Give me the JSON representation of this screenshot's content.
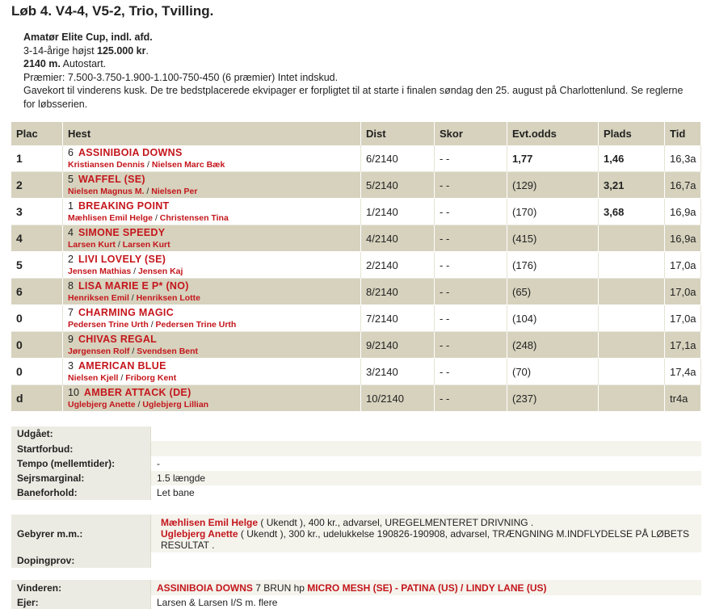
{
  "title": "Løb 4. V4-4, V5-2, Trio, Tvilling.",
  "race_info": {
    "line1": "Amatør Elite Cup, indl. afd.",
    "line2_prefix": "3-14-årige højst ",
    "line2_amount": "125.000 kr",
    "line2_suffix": ".",
    "line3_distance": "2140 m.",
    "line3_start": " Autostart.",
    "line4": "Præmier: 7.500-3.750-1.900-1.100-750-450 (6 præmier) Intet indskud.",
    "line5": "Gavekort til vinderens kusk. De tre bedstplacerede ekvipager er forpligtet til at starte i finalen søndag den 25. august på Charlottenlund. Se reglerne for løbsserien."
  },
  "table": {
    "headers": [
      "Plac",
      "Hest",
      "Dist",
      "Skor",
      "Evt.odds",
      "Plads",
      "Tid"
    ],
    "rows": [
      {
        "plac": "1",
        "num": "6",
        "horse": "ASSINIBOIA DOWNS",
        "driver": "Kristiansen Dennis",
        "trainer": "Nielsen Marc Bæk",
        "dist": "6/2140",
        "skor": "- -",
        "odds": "1,77",
        "plads": "1,46",
        "tid": "16,3a"
      },
      {
        "plac": "2",
        "num": "5",
        "horse": "WAFFEL (SE)",
        "driver": "Nielsen Magnus M.",
        "trainer": "Nielsen Per",
        "dist": "5/2140",
        "skor": "- -",
        "odds": "(129)",
        "plads": "3,21",
        "tid": "16,7a"
      },
      {
        "plac": "3",
        "num": "1",
        "horse": "BREAKING POINT",
        "driver": "Mæhlisen Emil Helge",
        "trainer": "Christensen Tina",
        "dist": "1/2140",
        "skor": "- -",
        "odds": "(170)",
        "plads": "3,68",
        "tid": "16,9a"
      },
      {
        "plac": "4",
        "num": "4",
        "horse": "SIMONE SPEEDY",
        "driver": "Larsen Kurt",
        "trainer": "Larsen Kurt",
        "dist": "4/2140",
        "skor": "- -",
        "odds": "(415)",
        "plads": "",
        "tid": "16,9a"
      },
      {
        "plac": "5",
        "num": "2",
        "horse": "LIVI LOVELY (SE)",
        "driver": "Jensen Mathias",
        "trainer": "Jensen Kaj",
        "dist": "2/2140",
        "skor": "- -",
        "odds": "(176)",
        "plads": "",
        "tid": "17,0a"
      },
      {
        "plac": "6",
        "num": "8",
        "horse": "LISA MARIE E P* (NO)",
        "driver": "Henriksen Emil",
        "trainer": "Henriksen Lotte",
        "dist": "8/2140",
        "skor": "- -",
        "odds": "(65)",
        "plads": "",
        "tid": "17,0a"
      },
      {
        "plac": "0",
        "num": "7",
        "horse": "CHARMING MAGIC",
        "driver": "Pedersen Trine Urth",
        "trainer": "Pedersen Trine Urth",
        "dist": "7/2140",
        "skor": "- -",
        "odds": "(104)",
        "plads": "",
        "tid": "17,0a"
      },
      {
        "plac": "0",
        "num": "9",
        "horse": "CHIVAS REGAL",
        "driver": "Jørgensen Rolf",
        "trainer": "Svendsen Bent",
        "dist": "9/2140",
        "skor": "- -",
        "odds": "(248)",
        "plads": "",
        "tid": "17,1a"
      },
      {
        "plac": "0",
        "num": "3",
        "horse": "AMERICAN BLUE",
        "driver": "Nielsen Kjell",
        "trainer": "Friborg Kent",
        "dist": "3/2140",
        "skor": "- -",
        "odds": "(70)",
        "plads": "",
        "tid": "17,4a"
      },
      {
        "plac": "d",
        "num": "10",
        "horse": "AMBER ATTACK (DE)",
        "driver": "Uglebjerg Anette",
        "trainer": "Uglebjerg Lillian",
        "dist": "10/2140",
        "skor": "- -",
        "odds": "(237)",
        "plads": "",
        "tid": "tr4a"
      }
    ]
  },
  "details": {
    "udgaaet_label": "Udgået:",
    "udgaaet_value": "",
    "startforbud_label": "Startforbud:",
    "startforbud_value": "",
    "tempo_label": "Tempo (mellemtider):",
    "tempo_value": "-",
    "sejr_label": "Sejrsmarginal:",
    "sejr_value": "1.5 længde",
    "bane_label": "Baneforhold:",
    "bane_value": "Let bane"
  },
  "fees": {
    "label": "Gebyrer m.m.:",
    "entries": [
      {
        "name": "Mæhlisen Emil Helge",
        "text": " ( Ukendt ), 400 kr., advarsel, UREGELMENTERET DRIVNING ."
      },
      {
        "name": "Uglebjerg Anette",
        "text": " ( Ukendt ), 300 kr., udelukkelse 190826-190908, advarsel, TRÆNGNING M.INDFLYDELSE PÅ LØBETS RESULTAT ."
      }
    ],
    "doping_label": "Dopingprov:",
    "doping_value": ""
  },
  "winner": {
    "label": "Vinderen:",
    "horse": "ASSINIBOIA DOWNS",
    "desc": " 7 BRUN hp ",
    "pedigree": "MICRO MESH (SE) - PATINA (US) / LINDY LANE (US)",
    "owner_label": "Ejer:",
    "owner": "Larsen & Larsen I/S m. flere"
  }
}
